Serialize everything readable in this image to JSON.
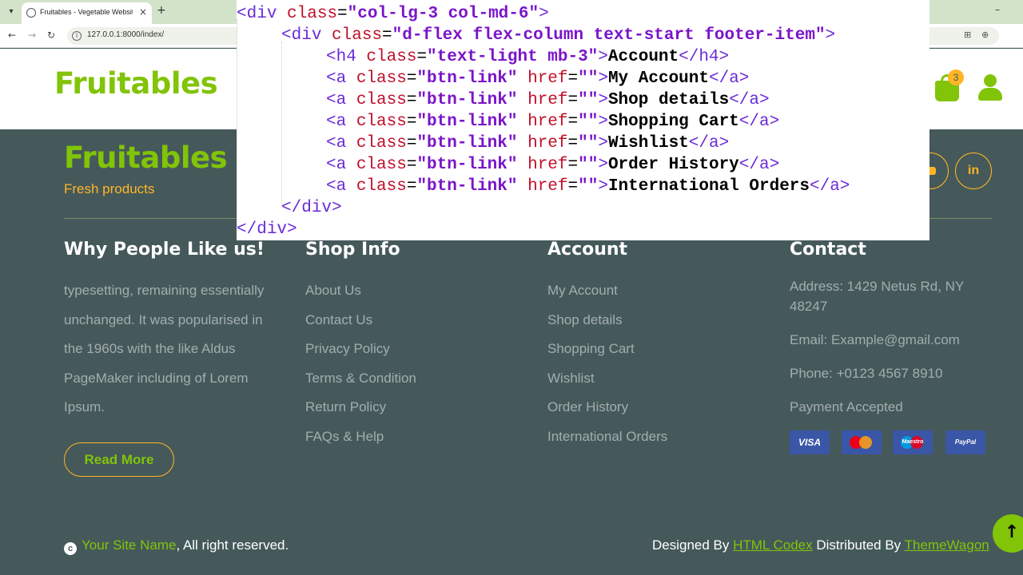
{
  "browser": {
    "tab_title": "Fruitables - Vegetable Website",
    "tab_close": "×",
    "new_tab": "+",
    "minimize": "–",
    "url": "127.0.0.1:8000/index/",
    "icons": [
      "tab-search-icon",
      "favicon-icon",
      "back-icon",
      "forward-icon",
      "reload-icon",
      "site-info-icon",
      "translate-icon",
      "zoom-icon",
      "bookmark-star-icon"
    ]
  },
  "header": {
    "logo": "Fruitables",
    "cart_count": "3",
    "brand_green": "#81c408",
    "accent_yellow": "#ffb524"
  },
  "footer": {
    "logo": "Fruitables",
    "tagline": "Fresh products",
    "social": [
      {
        "icon": "youtube-icon"
      },
      {
        "label": "in",
        "icon": "linkedin-icon"
      }
    ],
    "columns": {
      "why": {
        "title": "Why People Like us!",
        "text": "typesetting, remaining essentially unchanged. It was popularised in the 1960s with the like Aldus PageMaker including of Lorem Ipsum.",
        "button": "Read More"
      },
      "shop_info": {
        "title": "Shop Info",
        "links": [
          "About Us",
          "Contact Us",
          "Privacy Policy",
          "Terms & Condition",
          "Return Policy",
          "FAQs & Help"
        ]
      },
      "account": {
        "title": "Account",
        "links": [
          "My Account",
          "Shop details",
          "Shopping Cart",
          "Wishlist",
          "Order History",
          "International Orders"
        ]
      },
      "contact": {
        "title": "Contact",
        "address": "Address: 1429 Netus Rd, NY 48247",
        "email": "Email: Example@gmail.com",
        "phone": "Phone: +0123 4567 8910",
        "payment_label": "Payment Accepted",
        "payment_cards": [
          "VISA",
          "mastercard",
          "Maestro",
          "PayPal"
        ]
      }
    },
    "copyright": {
      "site_name": "Your Site Name",
      "rest": ", All right reserved."
    },
    "credits": {
      "designed_by": "Designed By ",
      "designer": "HTML Codex",
      "distributed_by": " Distributed By ",
      "distributor": "ThemeWagon"
    },
    "back_to_top": "↑"
  },
  "code": {
    "open_div": "div",
    "class_attr": "class",
    "outer_class": "\"col-lg-3 col-md-6\"",
    "inner_class": "\"d-flex flex-column text-start footer-item\"",
    "h4_class": "\"text-light mb-3\"",
    "heading": "Account",
    "link_class": "\"btn-link\"",
    "href_attr": "href",
    "href_val": "\"\"",
    "links": [
      "My Account",
      "Shop details",
      "Shopping Cart",
      "Wishlist",
      "Order History",
      "International Orders"
    ]
  }
}
